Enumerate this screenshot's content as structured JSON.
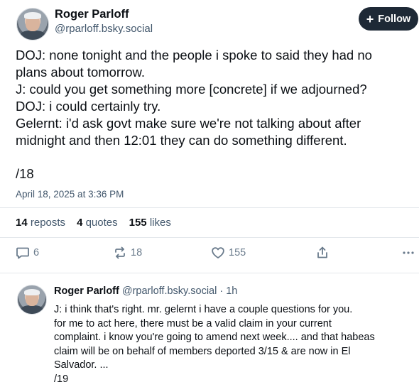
{
  "post": {
    "author_name": "Roger Parloff",
    "author_handle": "@rparloff.bsky.social",
    "follow_label": "Follow",
    "lines": [
      "DOJ: none tonight and the people i spoke to said they had no",
      "plans about tomorrow.",
      "J: could you get something more [concrete] if we adjourned?",
      "DOJ: i could certainly try.",
      "Gelernt: i'd ask govt make sure we're not talking about after",
      "midnight and then 12:01 they can do something different."
    ],
    "counter": "/18",
    "date": "April 18, 2025 at 3:36 PM",
    "stats": {
      "reposts_count": "14",
      "reposts_label": "reposts",
      "quotes_count": "4",
      "quotes_label": "quotes",
      "likes_count": "155",
      "likes_label": "likes"
    },
    "actions": {
      "reply_count": "6",
      "repost_count": "18",
      "like_count": "155"
    }
  },
  "reply": {
    "author_name": "Roger Parloff",
    "author_handle": "@rparloff.bsky.social",
    "time": "· 1h",
    "lines": [
      "J: i think that's right. mr. gelernt i have a couple questions for you.",
      "for me to act here, there must be a valid claim in your current",
      "complaint. i know you're going to amend next week.... and that habeas",
      "claim will be on behalf of members deported 3/15 & are now in El",
      "Salvador. ...",
      "/19"
    ]
  },
  "icons": {
    "follow": "plus-icon",
    "reply": "speech-bubble-icon",
    "repost": "repost-arrows-icon",
    "like": "heart-icon",
    "share": "share-icon",
    "more": "more-dots-icon"
  }
}
